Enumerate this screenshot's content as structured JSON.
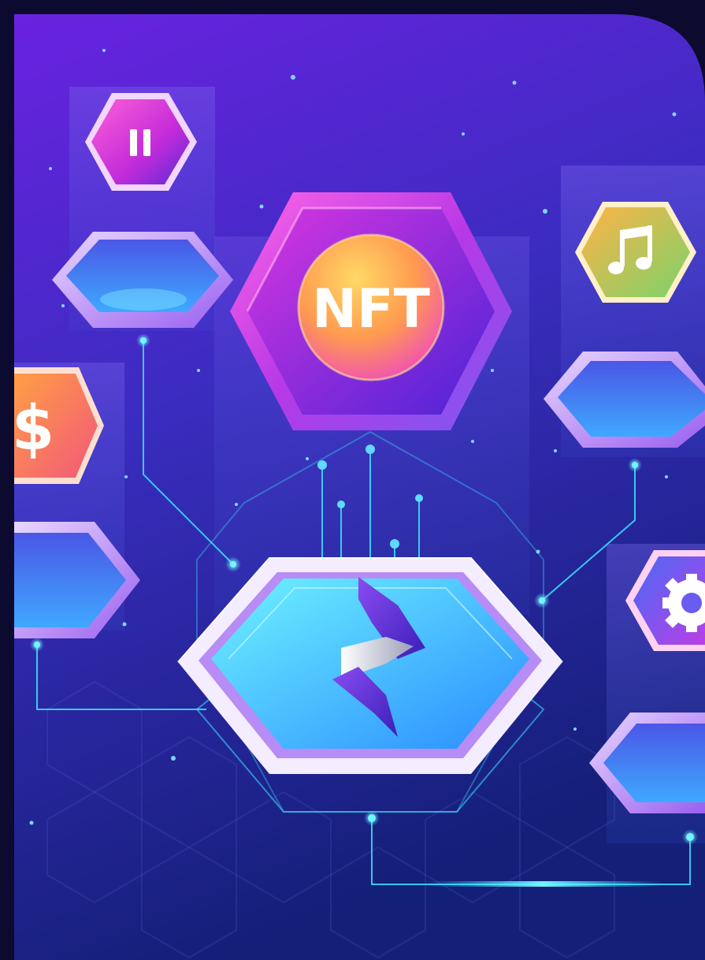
{
  "illustration": {
    "center_coin_label": "NFT",
    "dollar_symbol": "$",
    "icons": [
      "pause-icon",
      "music-note-icon",
      "dollar-icon",
      "gear-icon",
      "brand-logo-icon"
    ],
    "colors": {
      "background_dark": "#0c0a2e",
      "panel_top": "#5a1fd8",
      "panel_bottom": "#1a2b8a",
      "accent_cyan": "#39e6ff",
      "accent_magenta": "#e535d8",
      "accent_orange": "#ff8a3d"
    }
  }
}
